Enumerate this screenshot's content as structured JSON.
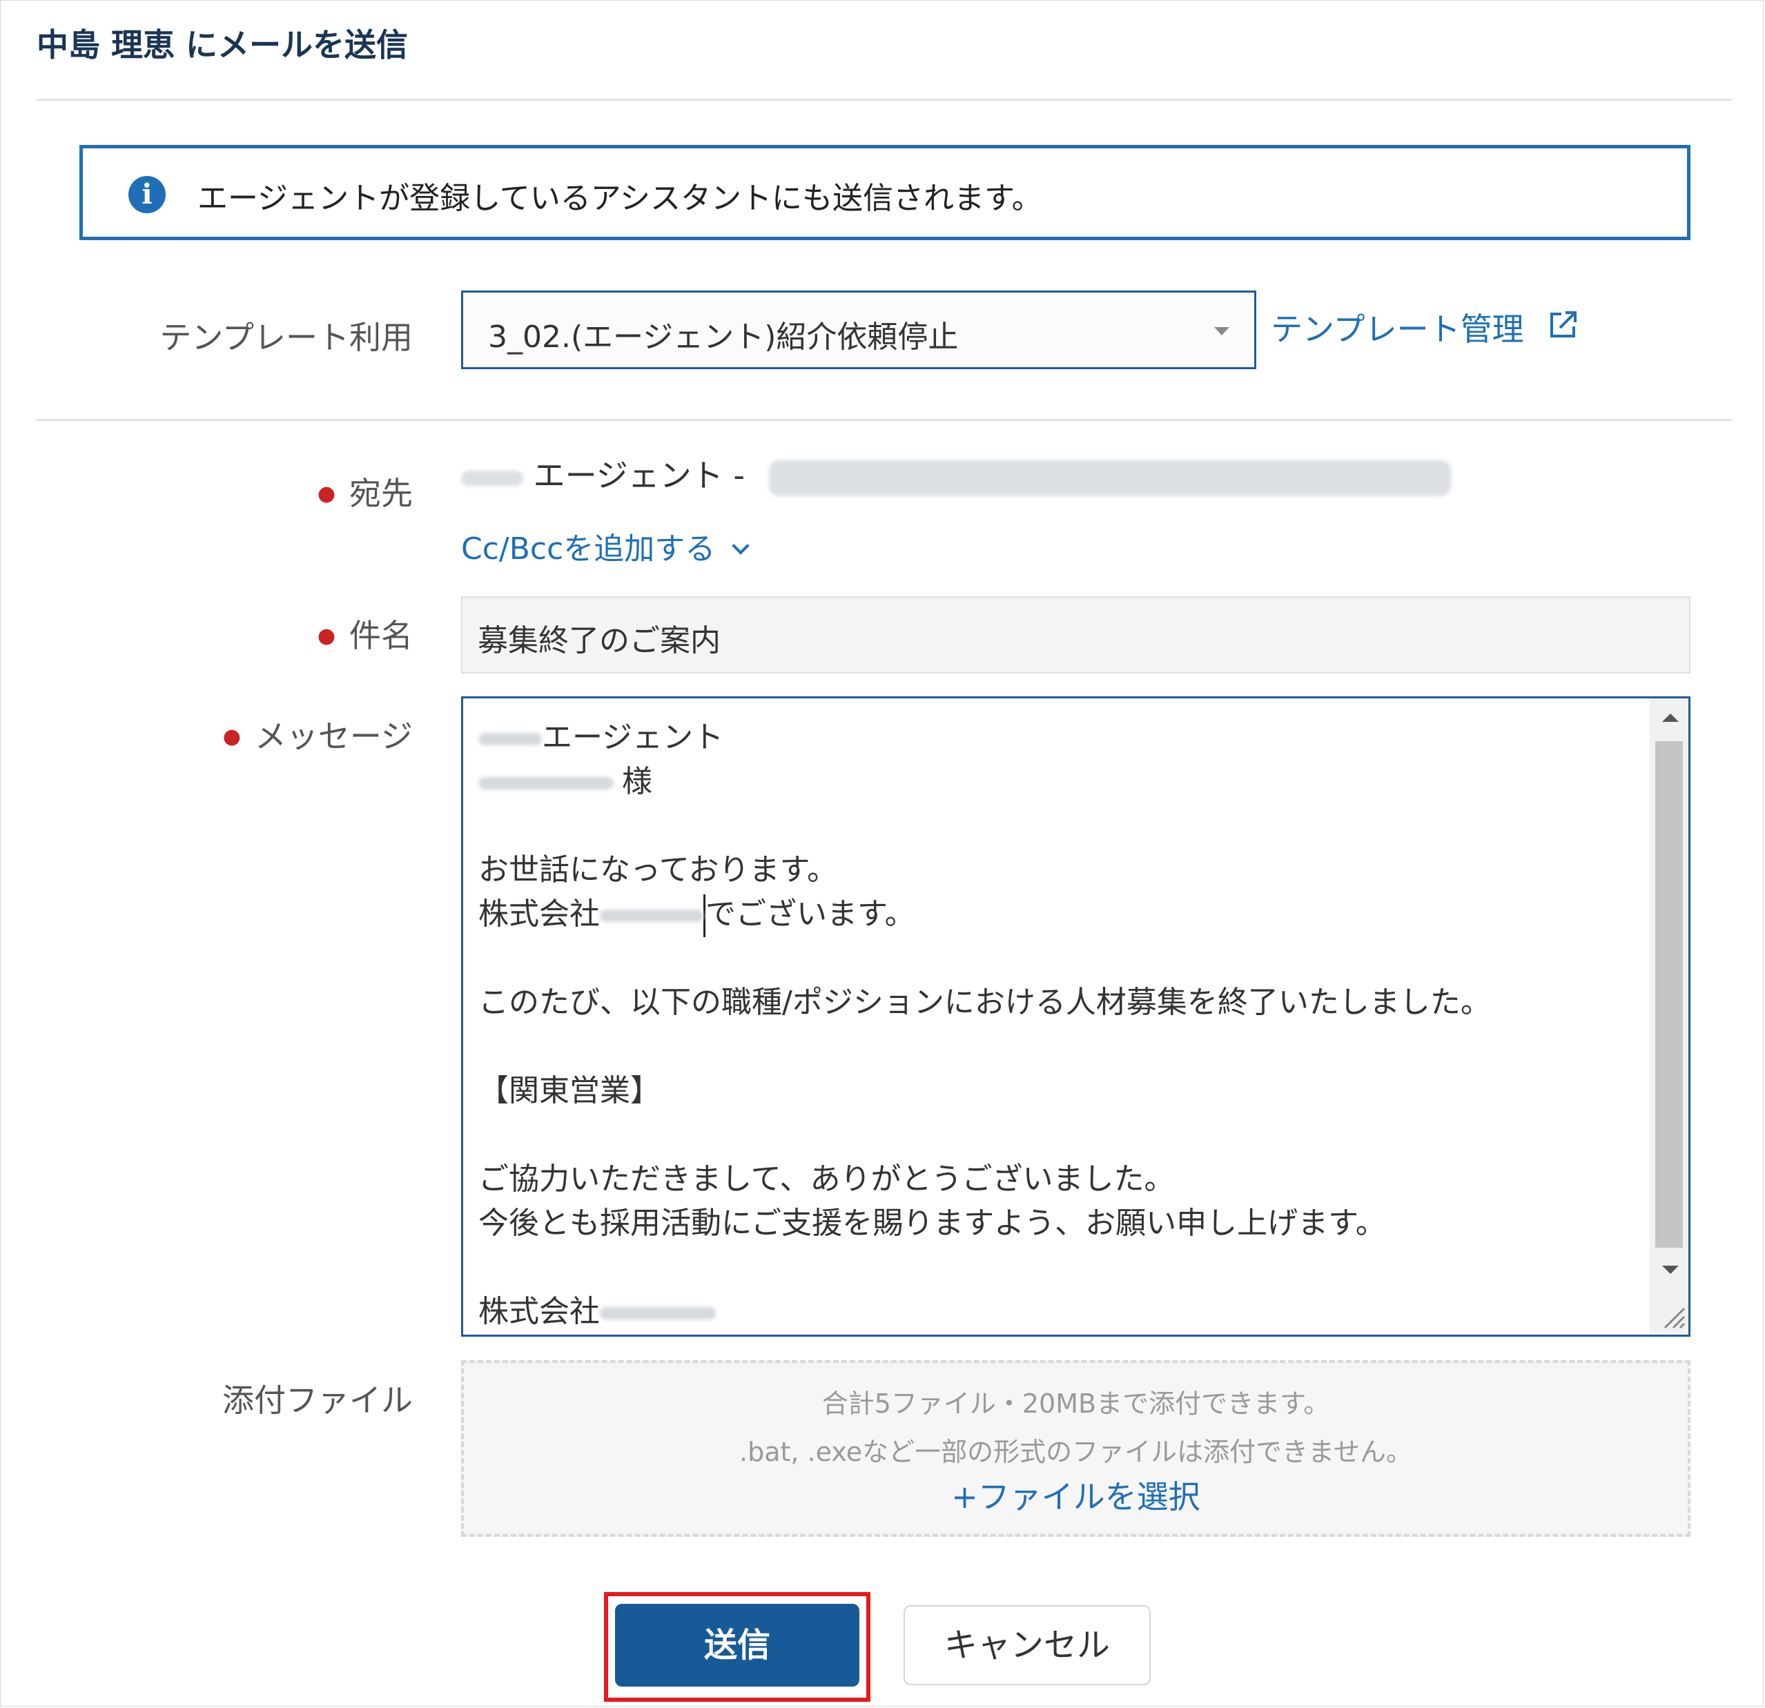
{
  "dialog": {
    "title": "中島 理恵 にメールを送信"
  },
  "info": {
    "text": "エージェントが登録しているアシスタントにも送信されます。",
    "icon": "info-icon"
  },
  "template": {
    "label": "テンプレート利用",
    "selected": "3_02.(エージェント)紹介依頼停止",
    "manage_link": "テンプレート管理"
  },
  "recipient": {
    "label": "宛先",
    "agent_suffix": "エージェント -",
    "cc_bcc_link": "Cc/Bccを追加する"
  },
  "subject": {
    "label": "件名",
    "value": "募集終了のご案内"
  },
  "message": {
    "label": "メッセージ",
    "line_agent": "エージェント",
    "line_sama": "様",
    "greeting": "お世話になっております。",
    "company_prefix": "株式会社",
    "company_suffix": "でございます。",
    "notice": "このたび、以下の職種/ポジションにおける人材募集を終了いたしました。",
    "position": "【関東営業】",
    "thanks": "ご協力いただきまして、ありがとうございました。",
    "request": "今後とも採用活動にご支援を賜りますよう、お願い申し上げます。",
    "signature_prefix": "株式会社"
  },
  "attachments": {
    "label": "添付ファイル",
    "limit_text": "合計5ファイル・20MBまで添付できます。",
    "format_text": ".bat, .exeなど一部の形式のファイルは添付できません。",
    "select_link": "+ファイルを選択"
  },
  "actions": {
    "send": "送信",
    "cancel": "キャンセル"
  },
  "colors": {
    "accent": "#1e6fb8",
    "primary_button": "#185a97",
    "required": "#cc2222",
    "highlight": "#e41a1a"
  }
}
